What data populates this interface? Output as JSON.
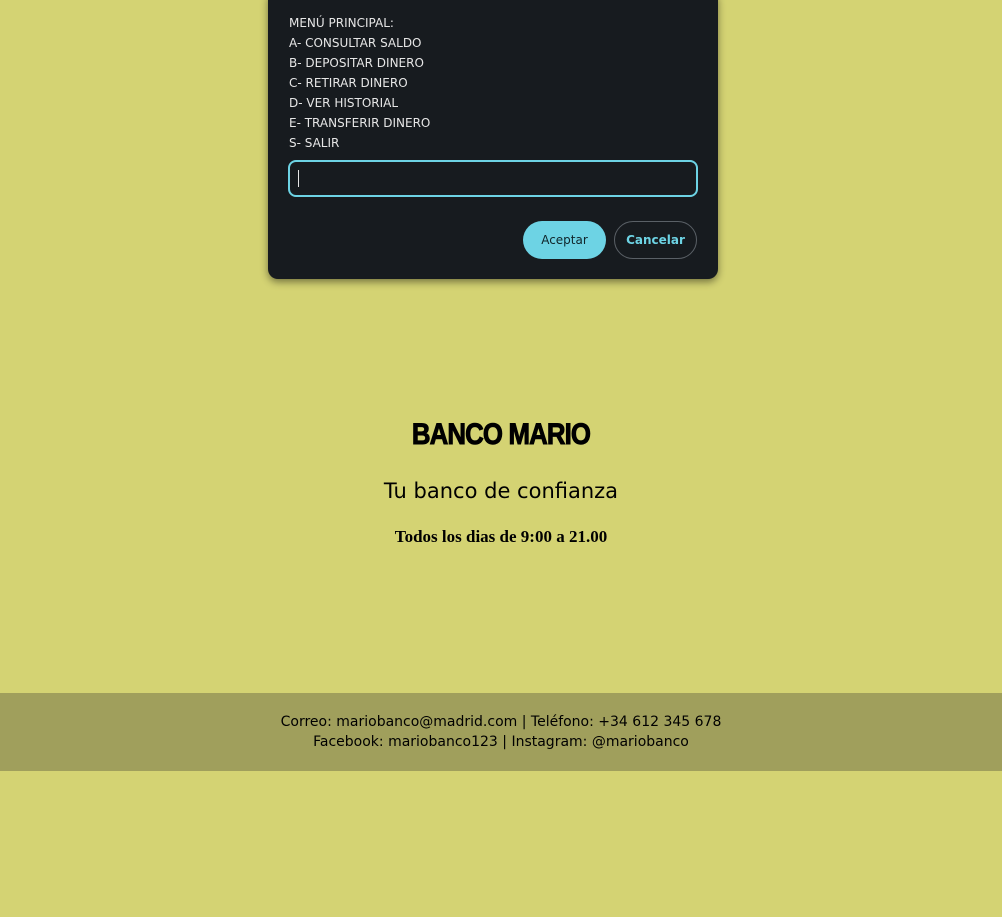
{
  "dialog": {
    "lines": [
      "MENÚ PRINCIPAL:",
      "A- CONSULTAR SALDO",
      "B- DEPOSITAR DINERO",
      "C- RETIRAR DINERO",
      "D- VER HISTORIAL",
      "E- TRANSFERIR DINERO",
      "S- SALIR"
    ],
    "input_value": "",
    "accept_label": "Aceptar",
    "cancel_label": "Cancelar"
  },
  "hero": {
    "brand": "BANCO MARIO",
    "tagline": "Tu banco de confianza",
    "hours": "Todos los dias de 9:00 a 21.00"
  },
  "footer": {
    "line1": "Correo: mariobanco@madrid.com | Teléfono: +34 612 345 678",
    "line2": "Facebook: mariobanco123 | Instagram: @mariobanco"
  },
  "colors": {
    "page_background": "#d4d373",
    "dialog_background": "#171b1f",
    "accent": "#6dd3e4",
    "footer_background": "#a09f5c"
  }
}
